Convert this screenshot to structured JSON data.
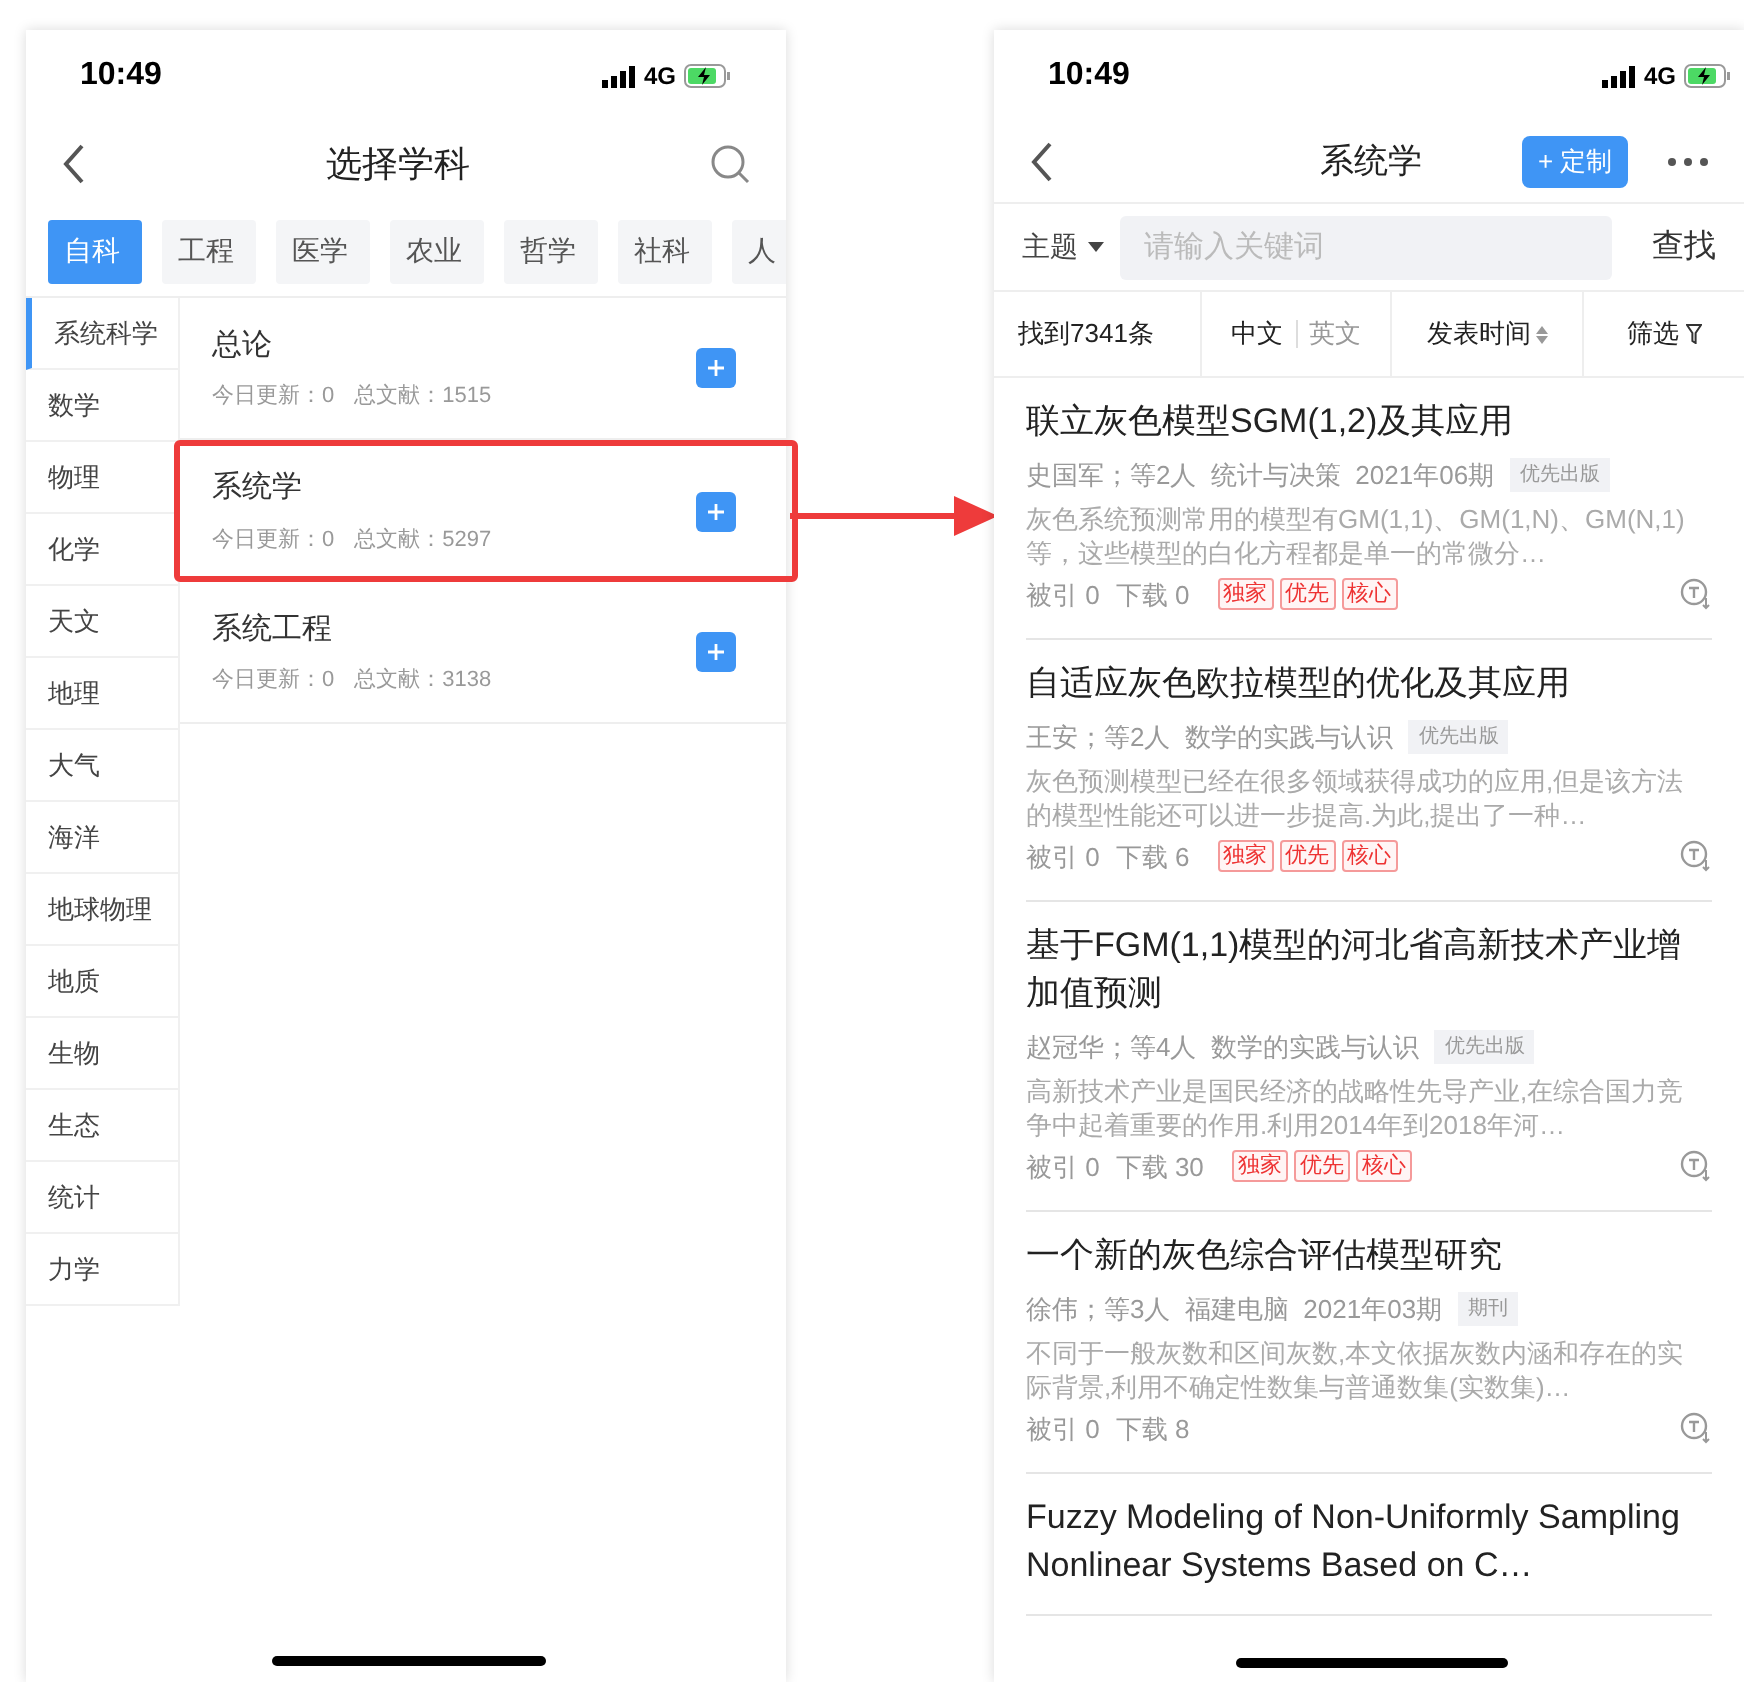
{
  "left_screen": {
    "status_bar": {
      "time": "10:49",
      "network": "4G"
    },
    "title": "选择学科",
    "categories": [
      {
        "label": "自科",
        "selected": true
      },
      {
        "label": "工程",
        "selected": false
      },
      {
        "label": "医学",
        "selected": false
      },
      {
        "label": "农业",
        "selected": false
      },
      {
        "label": "哲学",
        "selected": false
      },
      {
        "label": "社科",
        "selected": false
      },
      {
        "label": "人",
        "selected": false
      }
    ],
    "sidebar": [
      {
        "label": "系统科学",
        "selected": true
      },
      {
        "label": "数学",
        "selected": false
      },
      {
        "label": "物理",
        "selected": false
      },
      {
        "label": "化学",
        "selected": false
      },
      {
        "label": "天文",
        "selected": false
      },
      {
        "label": "地理",
        "selected": false
      },
      {
        "label": "大气",
        "selected": false
      },
      {
        "label": "海洋",
        "selected": false
      },
      {
        "label": "地球物理",
        "selected": false
      },
      {
        "label": "地质",
        "selected": false
      },
      {
        "label": "生物",
        "selected": false
      },
      {
        "label": "生态",
        "selected": false
      },
      {
        "label": "统计",
        "selected": false
      },
      {
        "label": "力学",
        "selected": false
      }
    ],
    "subjects": [
      {
        "name": "总论",
        "today": "今日更新：0",
        "total": "总文献：1515",
        "highlighted": false
      },
      {
        "name": "系统学",
        "today": "今日更新：0",
        "total": "总文献：5297",
        "highlighted": true
      },
      {
        "name": "系统工程",
        "today": "今日更新：0",
        "total": "总文献：3138",
        "highlighted": false
      }
    ]
  },
  "right_screen": {
    "status_bar": {
      "time": "10:49",
      "network": "4G"
    },
    "title": "系统学",
    "subscribe_button": "+ 定制",
    "search": {
      "scope": "主题",
      "placeholder": "请输入关键词",
      "button": "查找"
    },
    "filter_bar": {
      "count": "找到7341条",
      "languages": [
        {
          "label": "中文",
          "selected": true
        },
        {
          "label": "英文",
          "selected": false
        }
      ],
      "sort": "发表时间",
      "filter": "筛选"
    },
    "articles": [
      {
        "title": "联立灰色模型SGM(1,2)及其应用",
        "meta": "史国军；等2人  统计与决策  2021年06期",
        "badge": "优先出版",
        "abstract": "灰色系统预测常用的模型有GM(1,1)、GM(1,N)、GM(N,1)等，这些模型的白化方程都是单一的常微分…",
        "cited": "被引 0",
        "downloads": "下载 0",
        "tags": [
          "独家",
          "优先",
          "核心"
        ]
      },
      {
        "title": "自适应灰色欧拉模型的优化及其应用",
        "meta": "王安；等2人  数学的实践与认识",
        "badge": "优先出版",
        "abstract": "灰色预测模型已经在很多领域获得成功的应用,但是该方法的模型性能还可以进一步提高.为此,提出了一种…",
        "cited": "被引 0",
        "downloads": "下载 6",
        "tags": [
          "独家",
          "优先",
          "核心"
        ]
      },
      {
        "title": "基于FGM(1,1)模型的河北省高新技术产业增加值预测",
        "meta": "赵冠华；等4人  数学的实践与认识",
        "badge": "优先出版",
        "abstract": "高新技术产业是国民经济的战略性先导产业,在综合国力竞争中起着重要的作用.利用2014年到2018年河…",
        "cited": "被引 0",
        "downloads": "下载 30",
        "tags": [
          "独家",
          "优先",
          "核心"
        ]
      },
      {
        "title": "一个新的灰色综合评估模型研究",
        "meta": "徐伟；等3人  福建电脑  2021年03期",
        "badge": "期刊",
        "abstract": "不同于一般灰数和区间灰数,本文依据灰数内涵和存在的实际背景,利用不确定性数集与普通数集(实数集)…",
        "cited": "被引 0",
        "downloads": "下载 8"
      },
      {
        "title": "Fuzzy Modeling of Non-Uniformly Sampling Nonlinear Systems Based on C…"
      }
    ]
  }
}
